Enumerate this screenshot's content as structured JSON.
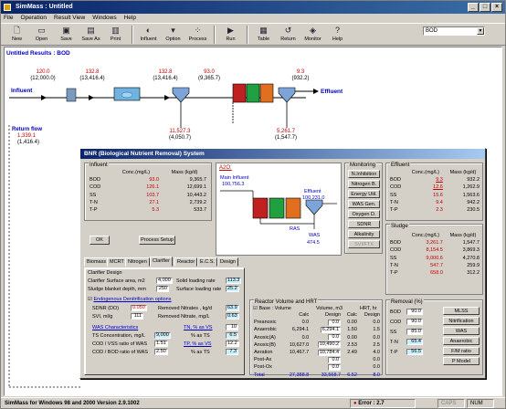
{
  "window": {
    "title": "SimMass : Untitled",
    "min": "_",
    "max": "□",
    "close": "×"
  },
  "menu": [
    "File",
    "Operation",
    "Result View",
    "Windows",
    "Help"
  ],
  "toolbar": [
    {
      "label": "New",
      "icon": "new-file-icon"
    },
    {
      "label": "Open",
      "icon": "open-folder-icon"
    },
    {
      "label": "Save",
      "icon": "save-disk-icon"
    },
    {
      "label": "Save As",
      "icon": "save-as-icon"
    },
    {
      "label": "Print",
      "icon": "printer-icon"
    },
    {
      "label": "Influent",
      "icon": "influent-icon"
    },
    {
      "label": "Option",
      "icon": "option-icon"
    },
    {
      "label": "Process",
      "icon": "process-icon"
    },
    {
      "label": "Run",
      "icon": "run-icon"
    },
    {
      "label": "Table",
      "icon": "table-icon"
    },
    {
      "label": "Return",
      "icon": "return-icon"
    },
    {
      "label": "Monitor",
      "icon": "monitor-icon"
    },
    {
      "label": "Help",
      "icon": "help-icon"
    }
  ],
  "unit_select": "BOD",
  "canvas": {
    "header": "Untitled   Results : BOD",
    "influent_label": "Influent",
    "effluent_label": "Effluent",
    "return_label": "Return flow",
    "return_v1": "1,339.1",
    "return_v2": "(1,416.4)",
    "flows": [
      {
        "a": "120.0",
        "b": "(12,000.0)"
      },
      {
        "a": "132.8",
        "b": "(13,416.4)"
      },
      {
        "a": "132.8",
        "b": "(13,416.4)"
      },
      {
        "a": "93.0",
        "b": "(9,365.7)"
      },
      {
        "a": "9.3",
        "b": "(932.2)"
      },
      {
        "a": "11,527.3",
        "b": "(4,050.7)"
      },
      {
        "a": "5,261.7",
        "b": "(1,547.7)"
      }
    ]
  },
  "dialog": {
    "title": "BNR (Biological Nutrient Removal) System",
    "influent": {
      "title": "Influent",
      "hdr1": "Conc.(mg/L)",
      "hdr2": "Mass (kg/d)",
      "rows": [
        {
          "n": "BOD",
          "c": "93.0",
          "m": "9,365.7"
        },
        {
          "n": "COD",
          "c": "126.1",
          "m": "12,699.1"
        },
        {
          "n": "SS",
          "c": "103.7",
          "m": "10,443.2"
        },
        {
          "n": "T-N",
          "c": "27.1",
          "m": "2,739.2"
        },
        {
          "n": "T-P",
          "c": "5.3",
          "m": "533.7"
        }
      ]
    },
    "diagram": {
      "ajoc": "A2O:",
      "main_influent": "Main Influent",
      "main_val": "100,756.3",
      "effluent": "Effluent",
      "eff_val": "100,231.0",
      "ras": "RAS",
      "was": "WAS",
      "was_val": "474.5"
    },
    "monitoring": {
      "title": "Monitoring",
      "buttons": [
        "N.Inhibition",
        "Nitrogen B.",
        "Energy Util.",
        "WAS Gen.",
        "Oxygen D.",
        "SDNR",
        "Alkalinity",
        "SVI/FTX"
      ]
    },
    "effluent": {
      "title": "Effluent",
      "hdr1": "Conc.(mg/L)",
      "hdr2": "Mass (kg/d)",
      "rows": [
        {
          "n": "BOD",
          "c": "9.3",
          "m": "932.2"
        },
        {
          "n": "COD",
          "c": "12.6",
          "m": "1,262.9"
        },
        {
          "n": "SS",
          "c": "15.6",
          "m": "1,563.6"
        },
        {
          "n": "T-N",
          "c": "9.4",
          "m": "942.2"
        },
        {
          "n": "T-P",
          "c": "2.3",
          "m": "230.5"
        }
      ]
    },
    "sludge": {
      "title": "Sludge",
      "hdr1": "Conc.(mg/L)",
      "hdr2": "Mass (kg/d)",
      "rows": [
        {
          "n": "BOD",
          "c": "3,261.7",
          "m": "1,547.7"
        },
        {
          "n": "COD",
          "c": "8,154.5",
          "m": "3,869.3"
        },
        {
          "n": "SS",
          "c": "9,000.6",
          "m": "4,270.8"
        },
        {
          "n": "T-N",
          "c": "547.7",
          "m": "259.9"
        },
        {
          "n": "T-P",
          "c": "658.0",
          "m": "312.2"
        }
      ]
    },
    "ok": "OK",
    "process_setup": "Process Setup",
    "tabs": [
      "Biomass",
      "MCRT",
      "Nitrogen",
      "Clarifier",
      "Reactor",
      "E.C.S.",
      "Design"
    ],
    "clarifier": {
      "title": "Clarifier Design",
      "area_label": "Clarifier Surface area, m2",
      "area_val": "4,000",
      "slr_label": "Solid loading rate",
      "slr_val": "113.3",
      "depth_label": "Sludge blanket depth, mm",
      "depth_val": "250",
      "sur_label": "Surface loading rate",
      "sur_val": "25.2",
      "endo_label": "Endogenous Denitrification options",
      "sdnr_label": "SDNR (DO)",
      "sdnr_val": "0.050",
      "rem_nit_label": "Removed Nitrates , kg/d",
      "rem_nit_val": "63.9",
      "svi_label": "SVI, ml/g",
      "svi_val": "111",
      "rem_nit2_label": "Removed Nitrate, mg/L",
      "rem_nit2_val": "0.63",
      "was_char": "WAS Characteristics",
      "ts_label": "TS Concentration, mg/L",
      "ts_val": "9,000",
      "cod_vss_label": "COD / VSS ratio of WAS",
      "cod_vss_val": "1.51",
      "cod_bod_label": "COD / BOD ratio of WAS",
      "cod_bod_val": "2.50",
      "tn_vs_label": "TN, % as VS",
      "tn_vs_val": "10",
      "vs_ts_label": "% as TS",
      "vs_ts_val": "6.5",
      "tp_vs_label": "TP, % as VS",
      "tp_vs_val": "12.2",
      "tp_ts_label": "% as TS",
      "tp_ts_val": "7.3"
    },
    "reactor": {
      "title": "Reactor Volume and HRT",
      "base_label": "Base : Volume",
      "vol_label": "Volume, m3",
      "hrt_label": "HRT, hr",
      "calc": "Calc",
      "design": "Design",
      "rows": [
        {
          "n": "Preanoxic",
          "vc": "0.0",
          "vd": "0.0",
          "hc": "0.00",
          "hd": "0.0"
        },
        {
          "n": "Anaerobic",
          "vc": "6,294.1",
          "vd": "6,294.1",
          "hc": "1.50",
          "hd": "1.5"
        },
        {
          "n": "Anoxic(A)",
          "vc": "0.0",
          "vd": "0.0",
          "hc": "0.00",
          "hd": "0.0"
        },
        {
          "n": "Anoxic(B)",
          "vc": "10,627.0",
          "vd": "10,490.2",
          "hc": "2.53",
          "hd": "2.5"
        },
        {
          "n": "Aeration",
          "vc": "10,467.7",
          "vd": "10,784.4",
          "hc": "2.49",
          "hd": "4.0"
        },
        {
          "n": "Post-Ax",
          "vc": "",
          "vd": "0.0",
          "hc": "",
          "hd": "0.0"
        },
        {
          "n": "Post-Ox",
          "vc": "",
          "vd": "0.0",
          "hc": "",
          "hd": "0.0"
        }
      ],
      "total_label": "Total",
      "total_vc": "27,388.8",
      "total_vd": "33,568.7",
      "total_hc": "6.52",
      "total_hd": "8.0"
    },
    "removal": {
      "title": "Removal (%)",
      "rows": [
        {
          "n": "BOD",
          "v": "90.0"
        },
        {
          "n": "COD",
          "v": "90.0"
        },
        {
          "n": "SS",
          "v": "85.0"
        },
        {
          "n": "T-N",
          "v": "65.4"
        },
        {
          "n": "T-P",
          "v": "56.5"
        }
      ],
      "buttons": [
        "MLSS",
        "Nitrification",
        "WAS",
        "Anaerobic",
        "F/M ratio",
        "P Model"
      ]
    }
  },
  "status": {
    "app": "SimMass for Windows 98 and 2000  Version 2.9.1002",
    "error": "Error : 2.7",
    "caps": "CAPS",
    "num": "NUM"
  },
  "colors": {
    "red": "#c00000",
    "blue": "#0000c0",
    "title": "#0a246a"
  }
}
